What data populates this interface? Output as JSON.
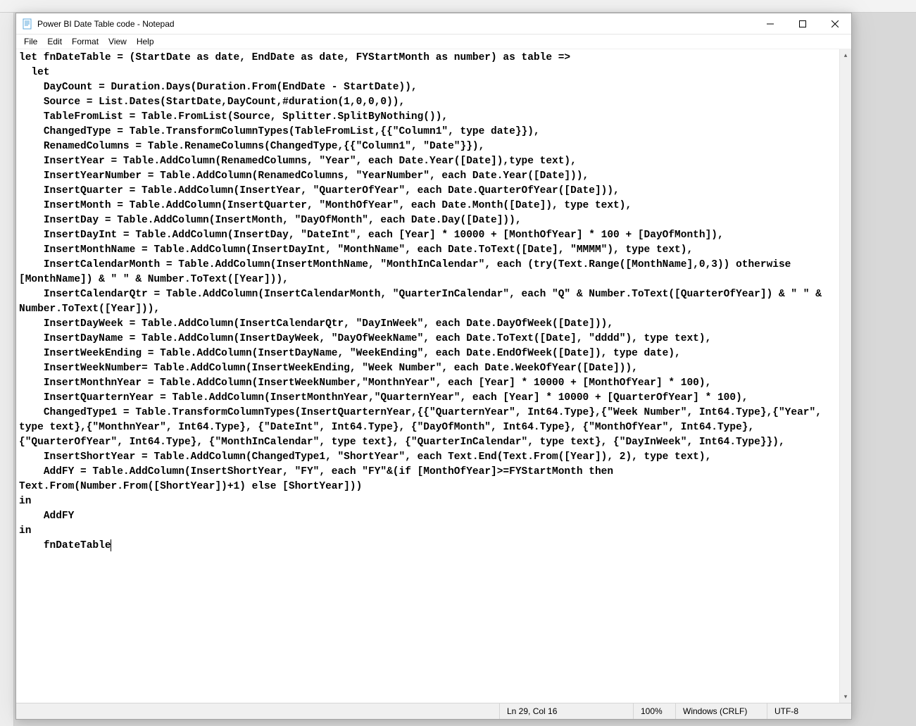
{
  "window": {
    "title": "Power BI Date Table code - Notepad"
  },
  "menu": {
    "file": "File",
    "edit": "Edit",
    "format": "Format",
    "view": "View",
    "help": "Help"
  },
  "editor": {
    "content": "let fnDateTable = (StartDate as date, EndDate as date, FYStartMonth as number) as table =>\n  let\n    DayCount = Duration.Days(Duration.From(EndDate - StartDate)),\n    Source = List.Dates(StartDate,DayCount,#duration(1,0,0,0)),\n    TableFromList = Table.FromList(Source, Splitter.SplitByNothing()),\n    ChangedType = Table.TransformColumnTypes(TableFromList,{{\"Column1\", type date}}),\n    RenamedColumns = Table.RenameColumns(ChangedType,{{\"Column1\", \"Date\"}}),\n    InsertYear = Table.AddColumn(RenamedColumns, \"Year\", each Date.Year([Date]),type text),\n    InsertYearNumber = Table.AddColumn(RenamedColumns, \"YearNumber\", each Date.Year([Date])),\n    InsertQuarter = Table.AddColumn(InsertYear, \"QuarterOfYear\", each Date.QuarterOfYear([Date])),\n    InsertMonth = Table.AddColumn(InsertQuarter, \"MonthOfYear\", each Date.Month([Date]), type text),\n    InsertDay = Table.AddColumn(InsertMonth, \"DayOfMonth\", each Date.Day([Date])),\n    InsertDayInt = Table.AddColumn(InsertDay, \"DateInt\", each [Year] * 10000 + [MonthOfYear] * 100 + [DayOfMonth]),\n    InsertMonthName = Table.AddColumn(InsertDayInt, \"MonthName\", each Date.ToText([Date], \"MMMM\"), type text),\n    InsertCalendarMonth = Table.AddColumn(InsertMonthName, \"MonthInCalendar\", each (try(Text.Range([MonthName],0,3)) otherwise [MonthName]) & \" \" & Number.ToText([Year])),\n    InsertCalendarQtr = Table.AddColumn(InsertCalendarMonth, \"QuarterInCalendar\", each \"Q\" & Number.ToText([QuarterOfYear]) & \" \" & Number.ToText([Year])),\n    InsertDayWeek = Table.AddColumn(InsertCalendarQtr, \"DayInWeek\", each Date.DayOfWeek([Date])),\n    InsertDayName = Table.AddColumn(InsertDayWeek, \"DayOfWeekName\", each Date.ToText([Date], \"dddd\"), type text),\n    InsertWeekEnding = Table.AddColumn(InsertDayName, \"WeekEnding\", each Date.EndOfWeek([Date]), type date),\n    InsertWeekNumber= Table.AddColumn(InsertWeekEnding, \"Week Number\", each Date.WeekOfYear([Date])),\n    InsertMonthnYear = Table.AddColumn(InsertWeekNumber,\"MonthnYear\", each [Year] * 10000 + [MonthOfYear] * 100),\n    InsertQuarternYear = Table.AddColumn(InsertMonthnYear,\"QuarternYear\", each [Year] * 10000 + [QuarterOfYear] * 100),\n    ChangedType1 = Table.TransformColumnTypes(InsertQuarternYear,{{\"QuarternYear\", Int64.Type},{\"Week Number\", Int64.Type},{\"Year\", type text},{\"MonthnYear\", Int64.Type}, {\"DateInt\", Int64.Type}, {\"DayOfMonth\", Int64.Type}, {\"MonthOfYear\", Int64.Type}, {\"QuarterOfYear\", Int64.Type}, {\"MonthInCalendar\", type text}, {\"QuarterInCalendar\", type text}, {\"DayInWeek\", Int64.Type}}),\n    InsertShortYear = Table.AddColumn(ChangedType1, \"ShortYear\", each Text.End(Text.From([Year]), 2), type text),\n    AddFY = Table.AddColumn(InsertShortYear, \"FY\", each \"FY\"&(if [MonthOfYear]>=FYStartMonth then Text.From(Number.From([ShortYear])+1) else [ShortYear]))\nin\n    AddFY\nin\n    fnDateTable"
  },
  "statusbar": {
    "cursor": "Ln 29, Col 16",
    "zoom": "100%",
    "line_ending": "Windows (CRLF)",
    "encoding": "UTF-8"
  }
}
